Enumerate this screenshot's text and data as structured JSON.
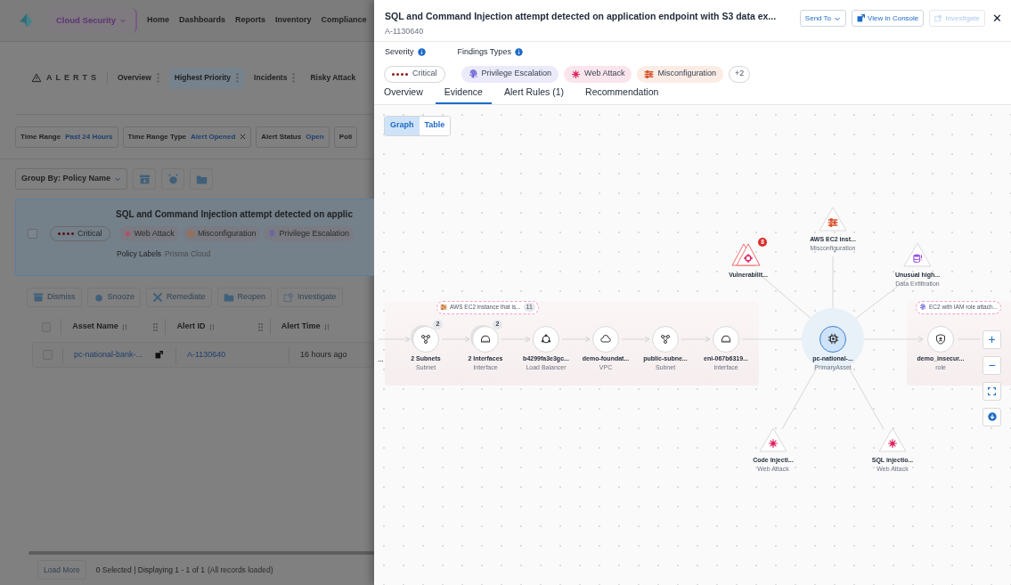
{
  "background": {
    "nav": {
      "product": "Cloud Security",
      "links": [
        "Home",
        "Dashboards",
        "Reports",
        "Inventory",
        "Compliance"
      ]
    },
    "alerts": {
      "title": "ALERTS",
      "tabs": [
        {
          "label": "Overview",
          "selected": false
        },
        {
          "label": "Highest Priority",
          "selected": true
        },
        {
          "label": "Incidents",
          "selected": false
        },
        {
          "label": "Risky Attack",
          "selected": false
        }
      ]
    },
    "filters": [
      {
        "label": "Time Range",
        "value": "Past 24 Hours",
        "removable": false
      },
      {
        "label": "Time Range Type",
        "value": "Alert Opened",
        "removable": true
      },
      {
        "label": "Alert Status",
        "value": "Open",
        "removable": false
      },
      {
        "label": "Poli"
      }
    ],
    "group_by": {
      "label": "Group By:",
      "value": "Policy Name"
    },
    "policy_card": {
      "title": "SQL and Command Injection attempt detected on applic",
      "checked": false,
      "severity": "Critical",
      "tags": [
        {
          "label": "Web Attack",
          "kind": "web_attack",
          "color": "#b84a5c"
        },
        {
          "label": "Misconfiguration",
          "kind": "misconfiguration",
          "color": "#a86a4a"
        },
        {
          "label": "Privilege Escalation",
          "kind": "privilege",
          "color": "#6a62a8"
        }
      ],
      "labels_key": "Policy Labels",
      "labels_value": "Prisma Cloud"
    },
    "actions": [
      {
        "label": "Dismiss",
        "kind": "dismiss"
      },
      {
        "label": "Snooze",
        "kind": "snooze"
      },
      {
        "label": "Remediate",
        "kind": "remediate"
      },
      {
        "label": "Reopen",
        "kind": "reopen"
      },
      {
        "label": "Investigate",
        "kind": "investigate"
      }
    ],
    "table": {
      "all_checked": false,
      "columns": [
        "Asset Name",
        "Alert ID",
        "Alert Time"
      ],
      "rows": [
        {
          "checked": false,
          "asset": "pc-national-bank-...",
          "alert_id": "A-1130640",
          "alert_time": "16 hours ago"
        }
      ]
    },
    "footer": {
      "load_more": "Load More",
      "summary": "0 Selected | Displaying 1 - 1 of 1",
      "note": "(All records loaded)"
    }
  },
  "drawer": {
    "title": "SQL and Command Injection attempt detected on application endpoint with S3 data ex...",
    "alert_id": "A-1130640",
    "buttons": [
      {
        "label": "Send To",
        "kind": "dropdown",
        "disabled": false
      },
      {
        "label": "View in Console",
        "kind": "external",
        "disabled": false
      },
      {
        "label": "Investigate",
        "kind": "investigate",
        "disabled": true
      }
    ],
    "close": "✕",
    "severity_label": "Severity",
    "findings_label": "Findings Types",
    "severity": "Critical",
    "findings": [
      {
        "label": "Privilege Escalation",
        "kind": "privilege",
        "color": "#6b63d6"
      },
      {
        "label": "Web Attack",
        "kind": "web_attack",
        "color": "#e0245e"
      },
      {
        "label": "Misconfiguration",
        "kind": "misconfiguration",
        "color": "#d9532c"
      }
    ],
    "more_findings": "+2",
    "tabs": [
      {
        "label": "Overview",
        "selected": false
      },
      {
        "label": "Evidence",
        "selected": true
      },
      {
        "label": "Alert Rules (1)",
        "selected": false
      },
      {
        "label": "Recommendation",
        "selected": false
      }
    ],
    "views": [
      {
        "label": "Graph",
        "selected": true
      },
      {
        "label": "Table",
        "selected": false
      }
    ],
    "graph": {
      "groups": [
        {
          "label": "AWS EC2 instance that is...",
          "count": "11",
          "kind": "misconfiguration"
        },
        {
          "label": "EC2 with IAM role attach...",
          "kind": "privilege"
        }
      ],
      "chain": [
        {
          "label": "…",
          "kind": "none"
        },
        {
          "label": "2 Subnets",
          "type": "Subnet",
          "kind": "subnet",
          "badge": "2"
        },
        {
          "label": "2 Interfaces",
          "type": "Interface",
          "kind": "interface",
          "badge": "2"
        },
        {
          "label": "b4299fa3e3gc...",
          "type": "Load Balancer",
          "kind": "load_balancer"
        },
        {
          "label": "demo-foundat...",
          "type": "VPC",
          "kind": "vpc"
        },
        {
          "label": "public-subne...",
          "type": "Subnet",
          "kind": "subnet"
        },
        {
          "label": "eni-067b6319...",
          "type": "Interface",
          "kind": "interface"
        }
      ],
      "primary": {
        "label": "pc-national-...",
        "type": "PrimaryAsset"
      },
      "role": {
        "label": "demo_insecur...",
        "type": "role"
      },
      "findings": [
        {
          "label": "Vulnerabilit...",
          "kind": "vulnerability",
          "badge": "8"
        },
        {
          "label": "AWS EC2 inst...",
          "category": "Misconfiguration",
          "kind": "misconfiguration"
        },
        {
          "label": "Unusual high...",
          "category": "Data Exfiltration",
          "kind": "exfiltration"
        },
        {
          "label": "Code Injecti...",
          "category": "Web Attack",
          "kind": "web_attack"
        },
        {
          "label": "SQL injectio...",
          "category": "Web Attack",
          "kind": "web_attack"
        }
      ],
      "controls": [
        {
          "label": "+",
          "kind": "zoom_in"
        },
        {
          "label": "−",
          "kind": "zoom_out"
        },
        {
          "kind": "fit"
        },
        {
          "kind": "download"
        }
      ]
    }
  }
}
